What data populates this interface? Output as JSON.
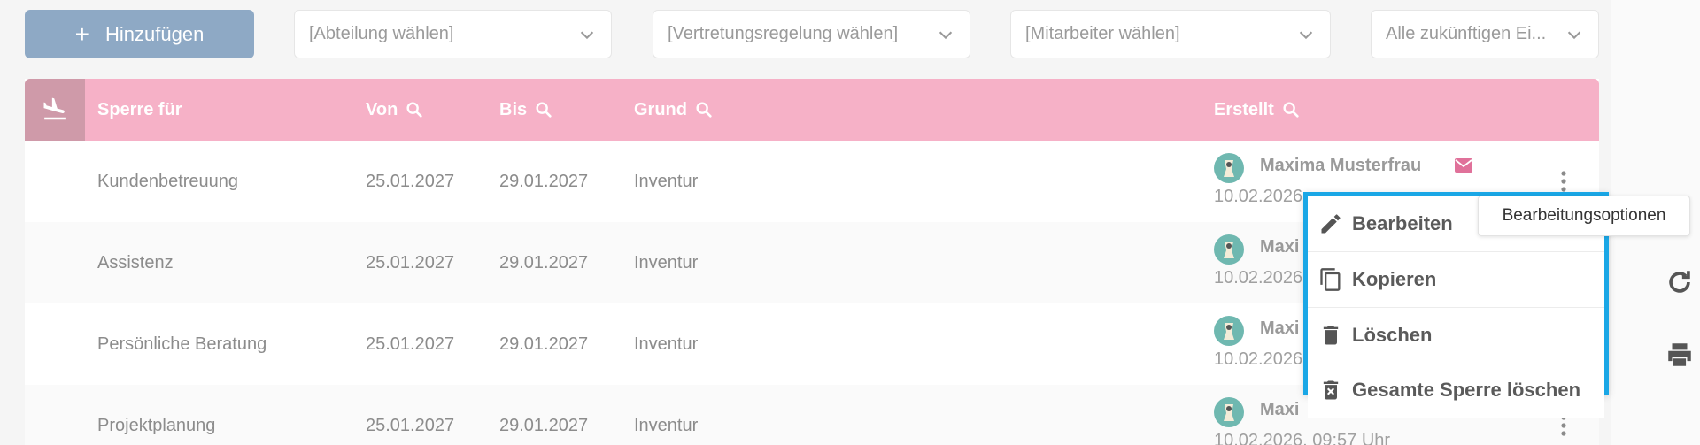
{
  "toolbar": {
    "add_label": "Hinzufügen",
    "department_placeholder": "[Abteilung wählen]",
    "substitution_placeholder": "[Vertretungsregelung wählen]",
    "employee_placeholder": "[Mitarbeiter wählen]",
    "range_value": "Alle zukünftigen Ei..."
  },
  "table": {
    "headers": {
      "sperre_fuer": "Sperre für",
      "von": "Von",
      "bis": "Bis",
      "grund": "Grund",
      "erstellt": "Erstellt"
    },
    "rows": [
      {
        "sperre_fuer": "Kundenbetreuung",
        "von": "25.01.2027",
        "bis": "29.01.2027",
        "grund": "Inventur",
        "creator": "Maxima Musterfrau",
        "created_at": "10.02.2026"
      },
      {
        "sperre_fuer": "Assistenz",
        "von": "25.01.2027",
        "bis": "29.01.2027",
        "grund": "Inventur",
        "creator": "Maxi",
        "created_at": "10.02.2026"
      },
      {
        "sperre_fuer": "Persönliche Beratung",
        "von": "25.01.2027",
        "bis": "29.01.2027",
        "grund": "Inventur",
        "creator": "Maxi",
        "created_at": "10.02.2026"
      },
      {
        "sperre_fuer": "Projektplanung",
        "von": "25.01.2027",
        "bis": "29.01.2027",
        "grund": "Inventur",
        "creator": "Maxi",
        "created_at": "10.02.2026, 09:57 Uhr"
      }
    ]
  },
  "menu": {
    "items": [
      {
        "label": "Bearbeiten",
        "icon": "pencil-icon"
      },
      {
        "label": "Kopieren",
        "icon": "copy-icon"
      },
      {
        "label": "Löschen",
        "icon": "trash-icon"
      },
      {
        "label": "Gesamte Sperre löschen",
        "icon": "trash-x-icon"
      }
    ]
  },
  "tooltip": "Bearbeitungsoptionen",
  "colors": {
    "header_pink": "#f6b1c7",
    "add_button": "#8ea9c5",
    "menu_border": "#1aa7e6",
    "mail_icon": "#e0719a"
  }
}
